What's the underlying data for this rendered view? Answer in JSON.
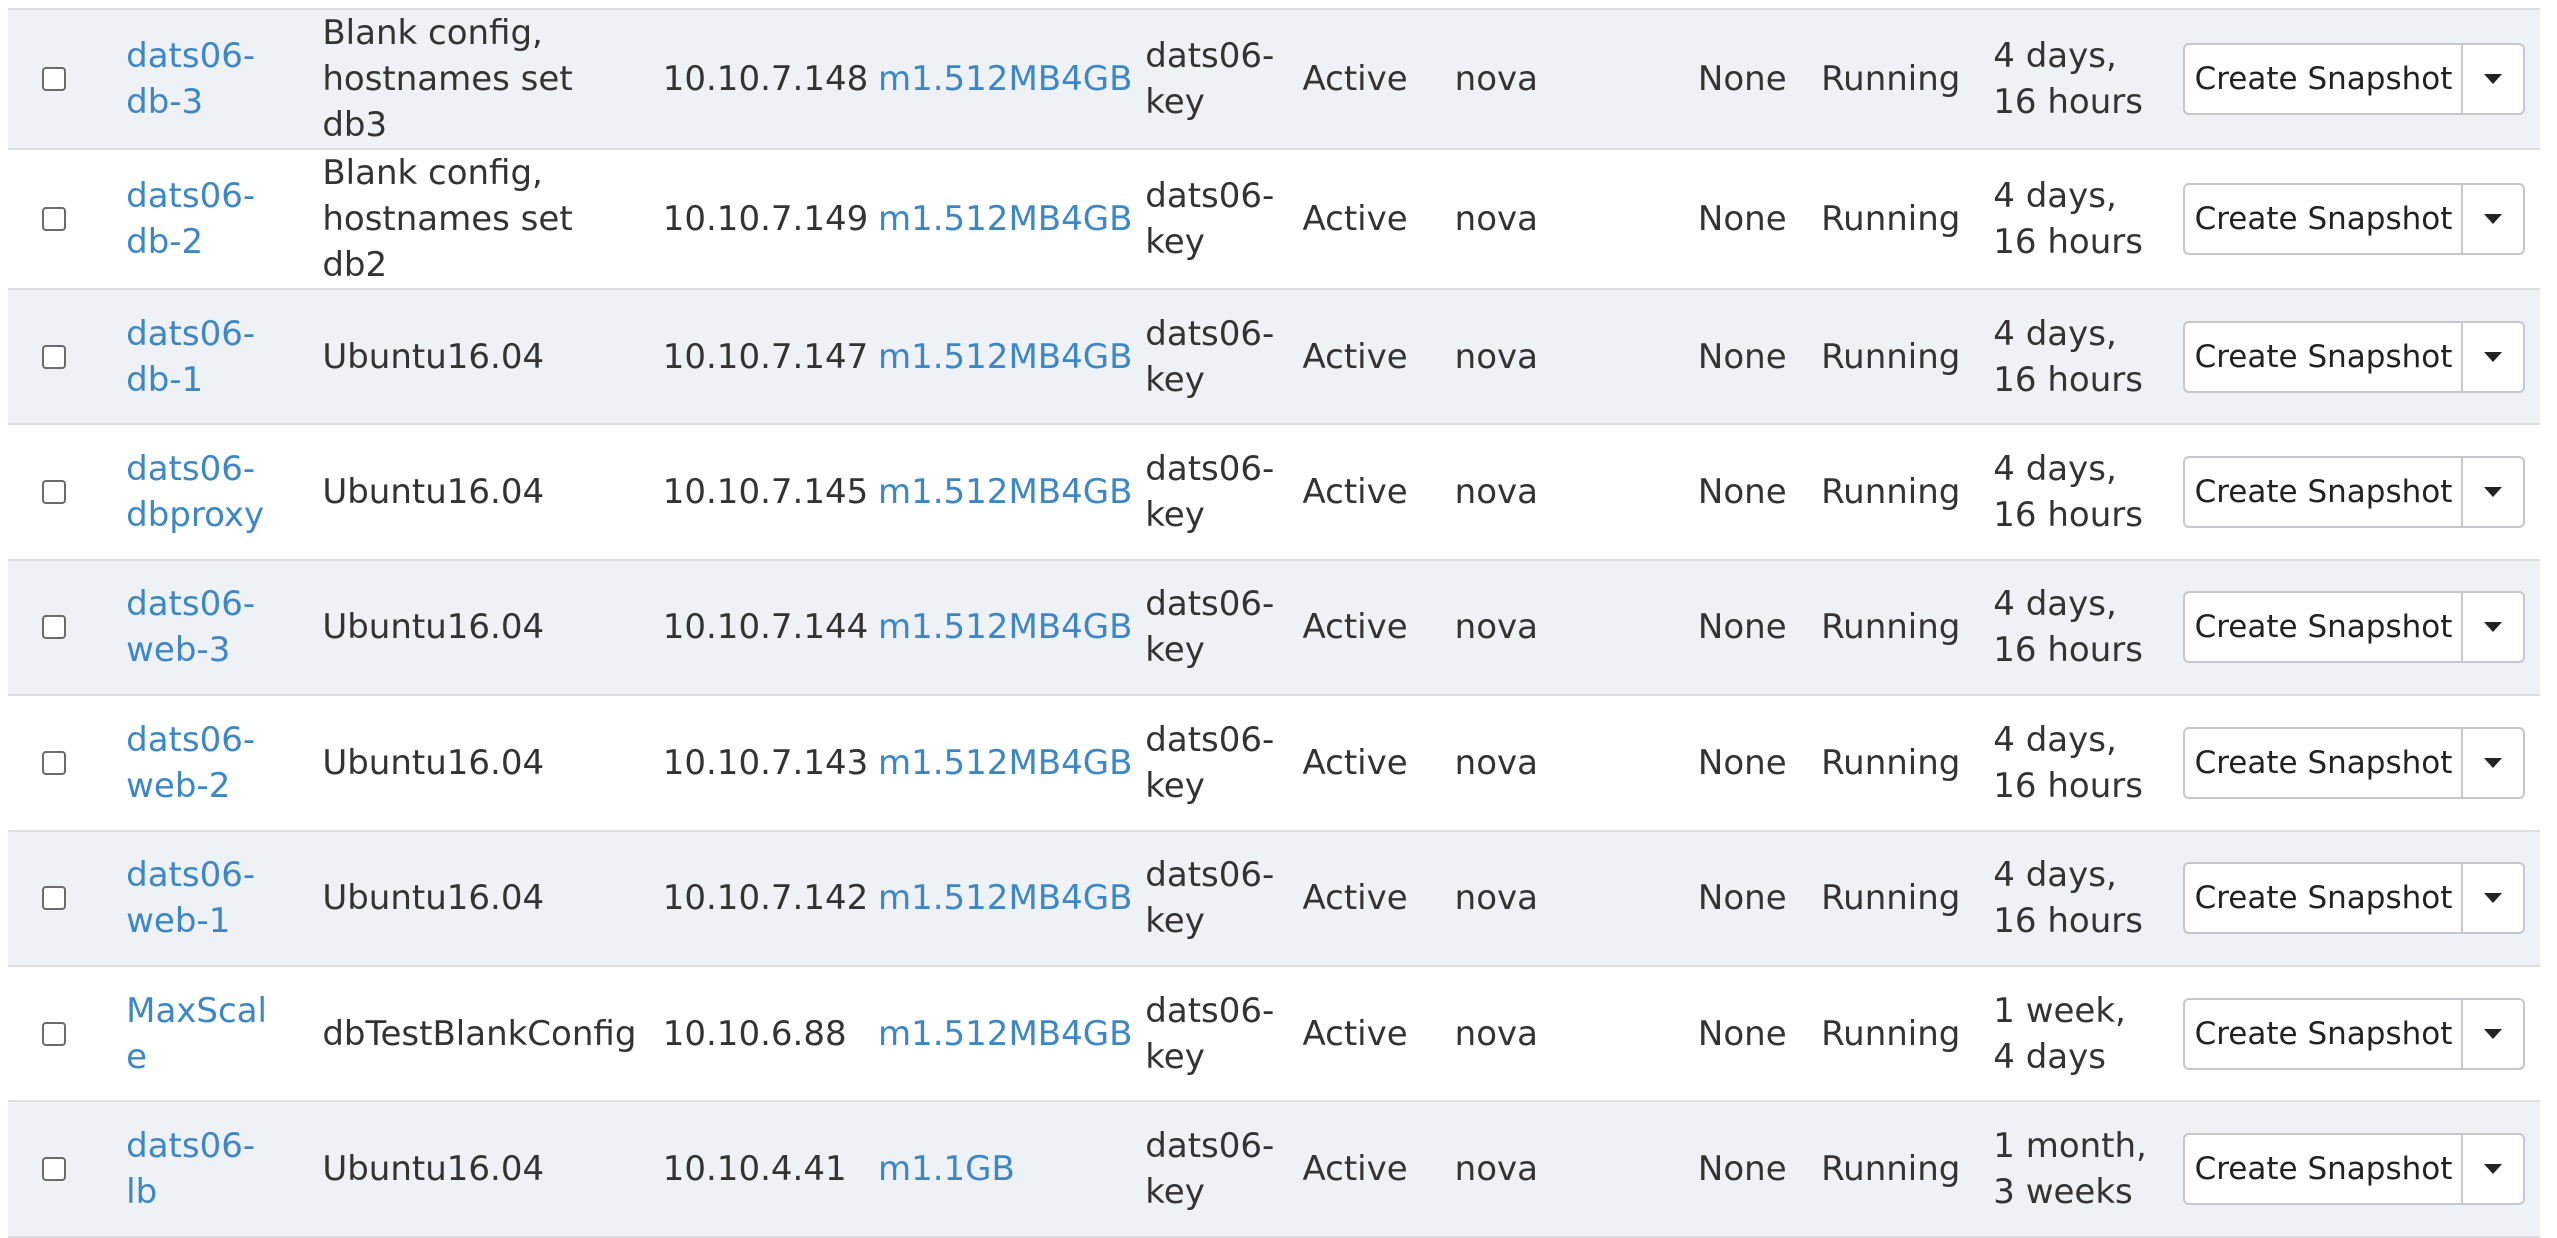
{
  "instances": [
    {
      "name": "dats06-db-3",
      "image": "Blank config, hostnames set db3",
      "ip": "10.10.7.148",
      "flavor": "m1.512MB4GB",
      "key_pair": "dats06-key",
      "status": "Active",
      "availability_zone": "nova",
      "task": "None",
      "power_state": "Running",
      "age": "4 days, 16 hours",
      "action_label": "Create Snapshot"
    },
    {
      "name": "dats06-db-2",
      "image": "Blank config, hostnames set db2",
      "ip": "10.10.7.149",
      "flavor": "m1.512MB4GB",
      "key_pair": "dats06-key",
      "status": "Active",
      "availability_zone": "nova",
      "task": "None",
      "power_state": "Running",
      "age": "4 days, 16 hours",
      "action_label": "Create Snapshot"
    },
    {
      "name": "dats06-db-1",
      "image": "Ubuntu16.04",
      "ip": "10.10.7.147",
      "flavor": "m1.512MB4GB",
      "key_pair": "dats06-key",
      "status": "Active",
      "availability_zone": "nova",
      "task": "None",
      "power_state": "Running",
      "age": "4 days, 16 hours",
      "action_label": "Create Snapshot"
    },
    {
      "name": "dats06-dbproxy",
      "image": "Ubuntu16.04",
      "ip": "10.10.7.145",
      "flavor": "m1.512MB4GB",
      "key_pair": "dats06-key",
      "status": "Active",
      "availability_zone": "nova",
      "task": "None",
      "power_state": "Running",
      "age": "4 days, 16 hours",
      "action_label": "Create Snapshot"
    },
    {
      "name": "dats06-web-3",
      "image": "Ubuntu16.04",
      "ip": "10.10.7.144",
      "flavor": "m1.512MB4GB",
      "key_pair": "dats06-key",
      "status": "Active",
      "availability_zone": "nova",
      "task": "None",
      "power_state": "Running",
      "age": "4 days, 16 hours",
      "action_label": "Create Snapshot"
    },
    {
      "name": "dats06-web-2",
      "image": "Ubuntu16.04",
      "ip": "10.10.7.143",
      "flavor": "m1.512MB4GB",
      "key_pair": "dats06-key",
      "status": "Active",
      "availability_zone": "nova",
      "task": "None",
      "power_state": "Running",
      "age": "4 days, 16 hours",
      "action_label": "Create Snapshot"
    },
    {
      "name": "dats06-web-1",
      "image": "Ubuntu16.04",
      "ip": "10.10.7.142",
      "flavor": "m1.512MB4GB",
      "key_pair": "dats06-key",
      "status": "Active",
      "availability_zone": "nova",
      "task": "None",
      "power_state": "Running",
      "age": "4 days, 16 hours",
      "action_label": "Create Snapshot"
    },
    {
      "name": "MaxScale",
      "image": "dbTestBlankConfig",
      "ip": "10.10.6.88",
      "flavor": "m1.512MB4GB",
      "key_pair": "dats06-key",
      "status": "Active",
      "availability_zone": "nova",
      "task": "None",
      "power_state": "Running",
      "age": "1 week, 4 days",
      "action_label": "Create Snapshot"
    },
    {
      "name": "dats06-lb",
      "image": "Ubuntu16.04",
      "ip": "10.10.4.41",
      "flavor": "m1.1GB",
      "key_pair": "dats06-key",
      "status": "Active",
      "availability_zone": "nova",
      "task": "None",
      "power_state": "Running",
      "age": "1 month, 3 weeks",
      "action_label": "Create Snapshot"
    }
  ],
  "icons": {
    "row_checkbox": "checkbox-icon",
    "actions_dropdown": "caret-down-icon"
  },
  "colors": {
    "link": "#3d87c7",
    "row_stripe": "#eef1f5",
    "border": "#dcdee2"
  }
}
